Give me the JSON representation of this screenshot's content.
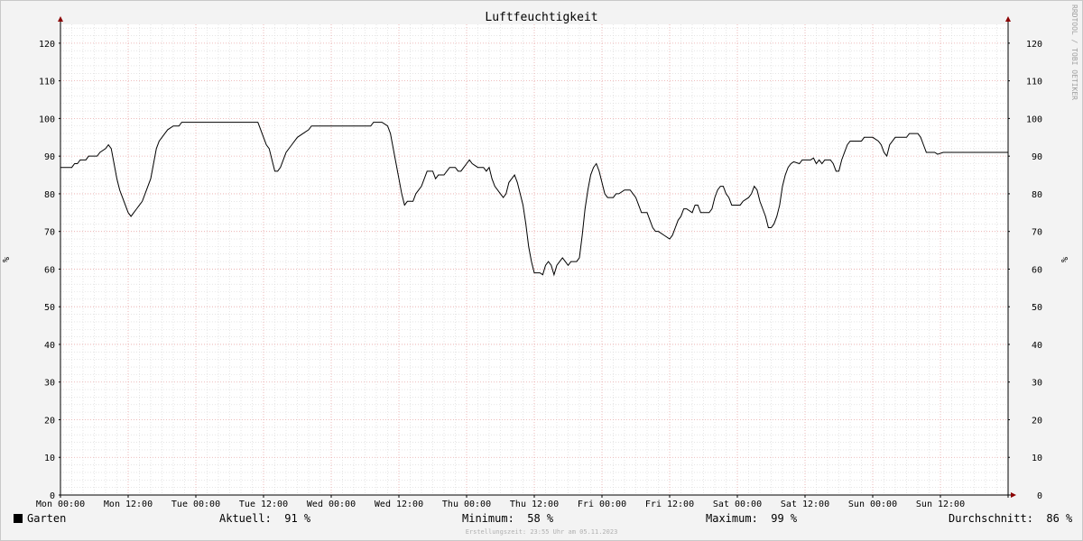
{
  "chart_data": {
    "type": "line",
    "title": "Luftfeuchtigkeit",
    "ylabel": "%",
    "ylim": [
      0,
      125
    ],
    "yticks": [
      0,
      10,
      20,
      30,
      40,
      50,
      60,
      70,
      80,
      90,
      100,
      110,
      120
    ],
    "xlim": [
      0,
      168
    ],
    "xticks": [
      {
        "x": 0,
        "label": "Mon 00:00"
      },
      {
        "x": 12,
        "label": "Mon 12:00"
      },
      {
        "x": 24,
        "label": "Tue 00:00"
      },
      {
        "x": 36,
        "label": "Tue 12:00"
      },
      {
        "x": 48,
        "label": "Wed 00:00"
      },
      {
        "x": 60,
        "label": "Wed 12:00"
      },
      {
        "x": 72,
        "label": "Thu 00:00"
      },
      {
        "x": 84,
        "label": "Thu 12:00"
      },
      {
        "x": 96,
        "label": "Fri 00:00"
      },
      {
        "x": 108,
        "label": "Fri 12:00"
      },
      {
        "x": 120,
        "label": "Sat 00:00"
      },
      {
        "x": 132,
        "label": "Sat 12:00"
      },
      {
        "x": 144,
        "label": "Sun 00:00"
      },
      {
        "x": 156,
        "label": "Sun 12:00"
      }
    ],
    "grid": true,
    "series": [
      {
        "name": "Garten",
        "color": "#000000",
        "points": [
          [
            0,
            87
          ],
          [
            2,
            87
          ],
          [
            2.5,
            88
          ],
          [
            3,
            88
          ],
          [
            3.5,
            89
          ],
          [
            4.5,
            89
          ],
          [
            5,
            90
          ],
          [
            6.5,
            90
          ],
          [
            7,
            91
          ],
          [
            8,
            92
          ],
          [
            8.5,
            93
          ],
          [
            9,
            92
          ],
          [
            9.5,
            88
          ],
          [
            10,
            84
          ],
          [
            10.5,
            81
          ],
          [
            11,
            79
          ],
          [
            11.5,
            77
          ],
          [
            12,
            75
          ],
          [
            12.5,
            74
          ],
          [
            13,
            75
          ],
          [
            13.5,
            76
          ],
          [
            14,
            77
          ],
          [
            14.5,
            78
          ],
          [
            15,
            80
          ],
          [
            15.5,
            82
          ],
          [
            16,
            84
          ],
          [
            16.5,
            88
          ],
          [
            17,
            92
          ],
          [
            17.5,
            94
          ],
          [
            18,
            95
          ],
          [
            18.5,
            96
          ],
          [
            19,
            97
          ],
          [
            20,
            98
          ],
          [
            21,
            98
          ],
          [
            21.5,
            99
          ],
          [
            26,
            99
          ],
          [
            30,
            99
          ],
          [
            34,
            99
          ],
          [
            35,
            99
          ],
          [
            35.5,
            97
          ],
          [
            36,
            95
          ],
          [
            36.5,
            93
          ],
          [
            37,
            92
          ],
          [
            37.5,
            89
          ],
          [
            38,
            86
          ],
          [
            38.5,
            86
          ],
          [
            39,
            87
          ],
          [
            39.5,
            89
          ],
          [
            40,
            91
          ],
          [
            41,
            93
          ],
          [
            42,
            95
          ],
          [
            43,
            96
          ],
          [
            44,
            97
          ],
          [
            44.5,
            98
          ],
          [
            50,
            98
          ],
          [
            55,
            98
          ],
          [
            55.5,
            99
          ],
          [
            57,
            99
          ],
          [
            58,
            98
          ],
          [
            58.5,
            96
          ],
          [
            59,
            92
          ],
          [
            59.5,
            88
          ],
          [
            60,
            84
          ],
          [
            60.5,
            80
          ],
          [
            61,
            77
          ],
          [
            61.5,
            78
          ],
          [
            62.5,
            78
          ],
          [
            63,
            80
          ],
          [
            64,
            82
          ],
          [
            64.5,
            84
          ],
          [
            65,
            86
          ],
          [
            66,
            86
          ],
          [
            66.5,
            84
          ],
          [
            67,
            85
          ],
          [
            68,
            85
          ],
          [
            68.5,
            86
          ],
          [
            69,
            87
          ],
          [
            70,
            87
          ],
          [
            70.5,
            86
          ],
          [
            71,
            86
          ],
          [
            71.5,
            87
          ],
          [
            72,
            88
          ],
          [
            72.5,
            89
          ],
          [
            73,
            88
          ],
          [
            74,
            87
          ],
          [
            75,
            87
          ],
          [
            75.5,
            86
          ],
          [
            76,
            87
          ],
          [
            76.5,
            84
          ],
          [
            77,
            82
          ],
          [
            78,
            80
          ],
          [
            78.5,
            79
          ],
          [
            79,
            80
          ],
          [
            79.5,
            83
          ],
          [
            80,
            84
          ],
          [
            80.5,
            85
          ],
          [
            81,
            83
          ],
          [
            81.5,
            80
          ],
          [
            82,
            77
          ],
          [
            82.5,
            72
          ],
          [
            83,
            66
          ],
          [
            83.5,
            62
          ],
          [
            84,
            59
          ],
          [
            85,
            59
          ],
          [
            85.5,
            58.5
          ],
          [
            86,
            61
          ],
          [
            86.5,
            62
          ],
          [
            87,
            61
          ],
          [
            87.5,
            58.5
          ],
          [
            88,
            61
          ],
          [
            88.5,
            62
          ],
          [
            89,
            63
          ],
          [
            89.5,
            62
          ],
          [
            90,
            61
          ],
          [
            90.5,
            62
          ],
          [
            91,
            62
          ],
          [
            91.5,
            62
          ],
          [
            92,
            63
          ],
          [
            92.5,
            69
          ],
          [
            93,
            76
          ],
          [
            93.5,
            81
          ],
          [
            94,
            85
          ],
          [
            94.5,
            87
          ],
          [
            95,
            88
          ],
          [
            95.5,
            86
          ],
          [
            96,
            83
          ],
          [
            96.5,
            80
          ],
          [
            97,
            79
          ],
          [
            98,
            79
          ],
          [
            98.5,
            80
          ],
          [
            99,
            80
          ],
          [
            100,
            81
          ],
          [
            101,
            81
          ],
          [
            101.5,
            80
          ],
          [
            102,
            79
          ],
          [
            102.5,
            77
          ],
          [
            103,
            75
          ],
          [
            104,
            75
          ],
          [
            104.5,
            73
          ],
          [
            105,
            71
          ],
          [
            105.5,
            70
          ],
          [
            106,
            70
          ],
          [
            107,
            69
          ],
          [
            108,
            68
          ],
          [
            108.5,
            69
          ],
          [
            109,
            71
          ],
          [
            109.5,
            73
          ],
          [
            110,
            74
          ],
          [
            110.5,
            76
          ],
          [
            111,
            76
          ],
          [
            112,
            75
          ],
          [
            112.5,
            77
          ],
          [
            113,
            77
          ],
          [
            113.5,
            75
          ],
          [
            115,
            75
          ],
          [
            115.5,
            76
          ],
          [
            116,
            79
          ],
          [
            116.5,
            81
          ],
          [
            117,
            82
          ],
          [
            117.5,
            82
          ],
          [
            118,
            80
          ],
          [
            118.5,
            79
          ],
          [
            119,
            77
          ],
          [
            120.5,
            77
          ],
          [
            121,
            78
          ],
          [
            122,
            79
          ],
          [
            122.5,
            80
          ],
          [
            123,
            82
          ],
          [
            123.5,
            81
          ],
          [
            124,
            78
          ],
          [
            124.5,
            76
          ],
          [
            125,
            74
          ],
          [
            125.5,
            71
          ],
          [
            126,
            71
          ],
          [
            126.5,
            72
          ],
          [
            127,
            74
          ],
          [
            127.5,
            77
          ],
          [
            128,
            82
          ],
          [
            128.5,
            85
          ],
          [
            129,
            87
          ],
          [
            129.5,
            88
          ],
          [
            130,
            88.5
          ],
          [
            131,
            88
          ],
          [
            131.5,
            89
          ],
          [
            133,
            89
          ],
          [
            133.5,
            89.5
          ],
          [
            134,
            88
          ],
          [
            134.5,
            89
          ],
          [
            135,
            88
          ],
          [
            135.5,
            89
          ],
          [
            136.5,
            89
          ],
          [
            137,
            88
          ],
          [
            137.5,
            86
          ],
          [
            138,
            86
          ],
          [
            138.5,
            89
          ],
          [
            139,
            91
          ],
          [
            139.5,
            93
          ],
          [
            140,
            94
          ],
          [
            142,
            94
          ],
          [
            142.5,
            95
          ],
          [
            144,
            95
          ],
          [
            145,
            94
          ],
          [
            145.5,
            93
          ],
          [
            146,
            91
          ],
          [
            146.5,
            90
          ],
          [
            147,
            93
          ],
          [
            147.5,
            94
          ],
          [
            148,
            95
          ],
          [
            150,
            95
          ],
          [
            150.5,
            96
          ],
          [
            152,
            96
          ],
          [
            152.5,
            95
          ],
          [
            153,
            93
          ],
          [
            153.5,
            91
          ],
          [
            155,
            91
          ],
          [
            155.5,
            90.5
          ],
          [
            156.5,
            91
          ],
          [
            168,
            91
          ]
        ]
      }
    ],
    "legend": {
      "series_label": "Garten",
      "current": "Aktuell:  91 %",
      "minimum": "Minimum:  58 %",
      "maximum": "Maximum:  99 %",
      "average": "Durchschnitt:  86 %"
    },
    "side_label": "RRDTOOL / TOBI OETIKER",
    "footer": "Erstellungszeit: 23:55 Uhr am 05.11.2023",
    "colors": {
      "background": "#f3f3f3",
      "plot_background": "#ffffff",
      "major_grid": "#e8a7a7",
      "minor_grid": "#d6d6d6",
      "axis": "#000000",
      "arrow": "#8b0000"
    }
  }
}
